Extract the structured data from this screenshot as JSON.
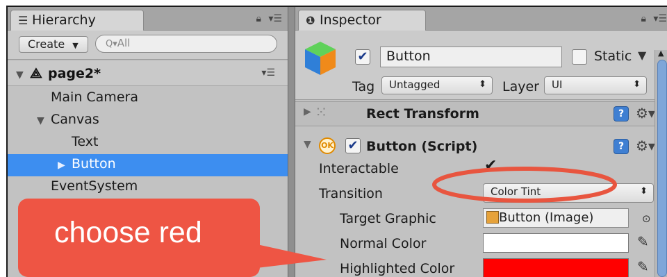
{
  "hierarchy": {
    "tab_label": "Hierarchy",
    "create_label": "Create",
    "search_placeholder": "All",
    "scene_name": "page2*",
    "items": [
      {
        "label": "Main Camera",
        "depth": 1,
        "expandable": false,
        "selected": false
      },
      {
        "label": "Canvas",
        "depth": 1,
        "expandable": true,
        "selected": false
      },
      {
        "label": "Text",
        "depth": 2,
        "expandable": false,
        "selected": false
      },
      {
        "label": "Button",
        "depth": 2,
        "expandable": true,
        "selected": true
      },
      {
        "label": "EventSystem",
        "depth": 1,
        "expandable": false,
        "selected": false
      }
    ]
  },
  "inspector": {
    "tab_label": "Inspector",
    "object_name": "Button",
    "static_label": "Static",
    "tag_label": "Tag",
    "tag_value": "Untagged",
    "layer_label": "Layer",
    "layer_value": "UI",
    "rect_transform_label": "Rect Transform",
    "button_script_label": "Button (Script)",
    "ok_badge": "OK",
    "props": {
      "interactable_label": "Interactable",
      "transition_label": "Transition",
      "transition_value": "Color Tint",
      "target_graphic_label": "Target Graphic",
      "target_graphic_value": "Button (Image)",
      "normal_color_label": "Normal Color",
      "normal_color_value": "#ffffff",
      "highlighted_color_label": "Highlighted Color",
      "highlighted_color_value": "#ff0000"
    }
  },
  "annotation": {
    "callout_text": "choose red",
    "callout_color": "#ee5544",
    "ellipse_color": "#e8553f"
  }
}
